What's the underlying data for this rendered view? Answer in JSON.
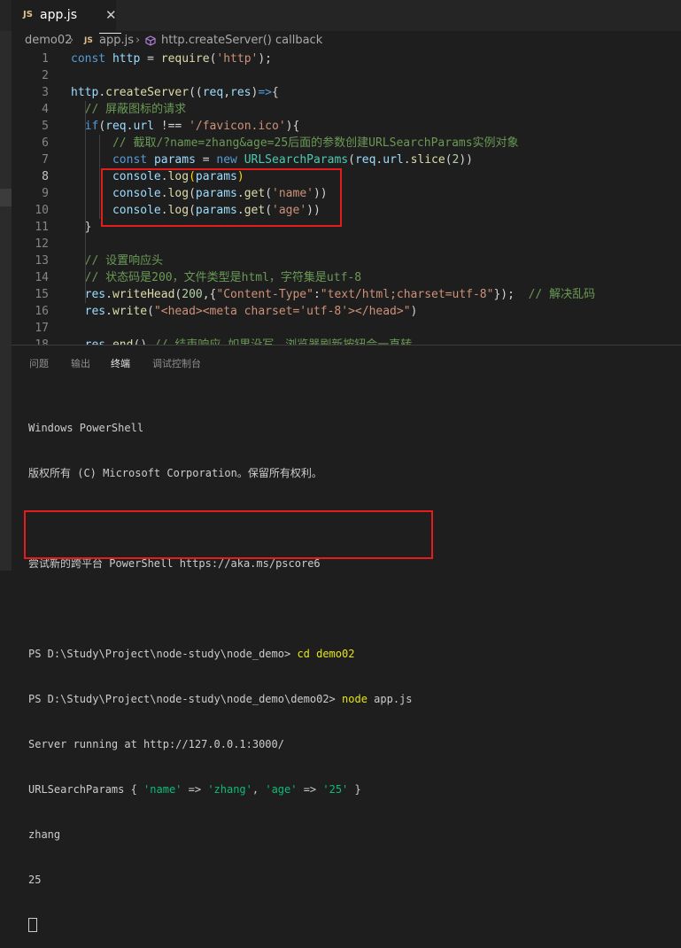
{
  "tab": {
    "icon": "JS",
    "title": "app.js",
    "close": "✕"
  },
  "breadcrumb": {
    "folder": "demo02",
    "file_icon": "JS",
    "file": "app.js",
    "symbol": "http.createServer() callback"
  },
  "editor": {
    "lines": [
      {
        "n": "1",
        "tokens": [
          {
            "t": "const ",
            "c": "k"
          },
          {
            "t": "http",
            "c": "v"
          },
          {
            "t": " = ",
            "c": "p"
          },
          {
            "t": "require",
            "c": "f"
          },
          {
            "t": "(",
            "c": "p"
          },
          {
            "t": "'http'",
            "c": "s"
          },
          {
            "t": ");",
            "c": "p"
          }
        ]
      },
      {
        "n": "2",
        "tokens": []
      },
      {
        "n": "3",
        "tokens": [
          {
            "t": "http",
            "c": "v"
          },
          {
            "t": ".",
            "c": "p"
          },
          {
            "t": "createServer",
            "c": "f"
          },
          {
            "t": "((",
            "c": "p"
          },
          {
            "t": "req",
            "c": "v"
          },
          {
            "t": ",",
            "c": "p"
          },
          {
            "t": "res",
            "c": "v"
          },
          {
            "t": ")",
            "c": "p"
          },
          {
            "t": "=>",
            "c": "k"
          },
          {
            "t": "{",
            "c": "p"
          }
        ]
      },
      {
        "n": "4",
        "tokens": [
          {
            "t": "  // 屏蔽图标的请求",
            "c": "c"
          }
        ]
      },
      {
        "n": "5",
        "tokens": [
          {
            "t": "  ",
            "c": "p"
          },
          {
            "t": "if",
            "c": "k"
          },
          {
            "t": "(",
            "c": "p"
          },
          {
            "t": "req",
            "c": "v"
          },
          {
            "t": ".",
            "c": "p"
          },
          {
            "t": "url",
            "c": "v"
          },
          {
            "t": " !== ",
            "c": "p"
          },
          {
            "t": "'/favicon.ico'",
            "c": "s"
          },
          {
            "t": "){",
            "c": "p"
          }
        ]
      },
      {
        "n": "6",
        "tokens": [
          {
            "t": "      // 截取/?name=zhang&age=25后面的参数创建URLSearchParams实例对象",
            "c": "c"
          }
        ]
      },
      {
        "n": "7",
        "tokens": [
          {
            "t": "      ",
            "c": "p"
          },
          {
            "t": "const ",
            "c": "k"
          },
          {
            "t": "params",
            "c": "v"
          },
          {
            "t": " = ",
            "c": "p"
          },
          {
            "t": "new ",
            "c": "k"
          },
          {
            "t": "URLSearchParams",
            "c": "t"
          },
          {
            "t": "(",
            "c": "p"
          },
          {
            "t": "req",
            "c": "v"
          },
          {
            "t": ".",
            "c": "p"
          },
          {
            "t": "url",
            "c": "v"
          },
          {
            "t": ".",
            "c": "p"
          },
          {
            "t": "slice",
            "c": "f"
          },
          {
            "t": "(",
            "c": "p"
          },
          {
            "t": "2",
            "c": "n"
          },
          {
            "t": "))",
            "c": "p"
          }
        ]
      },
      {
        "n": "8",
        "active": true,
        "tokens": [
          {
            "t": "      ",
            "c": "p"
          },
          {
            "t": "console",
            "c": "v"
          },
          {
            "t": ".",
            "c": "p"
          },
          {
            "t": "log",
            "c": "f"
          },
          {
            "t": "(",
            "c": "y"
          },
          {
            "t": "params",
            "c": "v"
          },
          {
            "t": ")",
            "c": "y"
          }
        ]
      },
      {
        "n": "9",
        "tokens": [
          {
            "t": "      ",
            "c": "p"
          },
          {
            "t": "console",
            "c": "v"
          },
          {
            "t": ".",
            "c": "p"
          },
          {
            "t": "log",
            "c": "f"
          },
          {
            "t": "(",
            "c": "p"
          },
          {
            "t": "params",
            "c": "v"
          },
          {
            "t": ".",
            "c": "p"
          },
          {
            "t": "get",
            "c": "f"
          },
          {
            "t": "(",
            "c": "p"
          },
          {
            "t": "'name'",
            "c": "s"
          },
          {
            "t": "))",
            "c": "p"
          }
        ]
      },
      {
        "n": "10",
        "tokens": [
          {
            "t": "      ",
            "c": "p"
          },
          {
            "t": "console",
            "c": "v"
          },
          {
            "t": ".",
            "c": "p"
          },
          {
            "t": "log",
            "c": "f"
          },
          {
            "t": "(",
            "c": "p"
          },
          {
            "t": "params",
            "c": "v"
          },
          {
            "t": ".",
            "c": "p"
          },
          {
            "t": "get",
            "c": "f"
          },
          {
            "t": "(",
            "c": "p"
          },
          {
            "t": "'age'",
            "c": "s"
          },
          {
            "t": "))",
            "c": "p"
          }
        ]
      },
      {
        "n": "11",
        "tokens": [
          {
            "t": "  }",
            "c": "p"
          }
        ]
      },
      {
        "n": "12",
        "tokens": []
      },
      {
        "n": "13",
        "tokens": [
          {
            "t": "  // 设置响应头",
            "c": "c"
          }
        ]
      },
      {
        "n": "14",
        "tokens": [
          {
            "t": "  // 状态码是200，文件类型是html，字符集是utf-8",
            "c": "c"
          }
        ]
      },
      {
        "n": "15",
        "tokens": [
          {
            "t": "  ",
            "c": "p"
          },
          {
            "t": "res",
            "c": "v"
          },
          {
            "t": ".",
            "c": "p"
          },
          {
            "t": "writeHead",
            "c": "f"
          },
          {
            "t": "(",
            "c": "p"
          },
          {
            "t": "200",
            "c": "n"
          },
          {
            "t": ",{",
            "c": "p"
          },
          {
            "t": "\"Content-Type\"",
            "c": "s"
          },
          {
            "t": ":",
            "c": "p"
          },
          {
            "t": "\"text/html;charset=utf-8\"",
            "c": "s"
          },
          {
            "t": "});  ",
            "c": "p"
          },
          {
            "t": "// 解决乱码",
            "c": "c"
          }
        ]
      },
      {
        "n": "16",
        "tokens": [
          {
            "t": "  ",
            "c": "p"
          },
          {
            "t": "res",
            "c": "v"
          },
          {
            "t": ".",
            "c": "p"
          },
          {
            "t": "write",
            "c": "f"
          },
          {
            "t": "(",
            "c": "p"
          },
          {
            "t": "\"<head><meta charset='utf-8'></head>\"",
            "c": "s"
          },
          {
            "t": ")",
            "c": "p"
          }
        ]
      },
      {
        "n": "17",
        "tokens": []
      },
      {
        "n": "18",
        "tokens": [
          {
            "t": "  ",
            "c": "p"
          },
          {
            "t": "res",
            "c": "v"
          },
          {
            "t": ".",
            "c": "p"
          },
          {
            "t": "end",
            "c": "f"
          },
          {
            "t": "() ",
            "c": "p"
          },
          {
            "t": "// 结束响应,如果没写，浏览器刷新按钮会一直转",
            "c": "c"
          }
        ]
      }
    ]
  },
  "panel": {
    "tabs": [
      "问题",
      "输出",
      "终端",
      "调试控制台"
    ],
    "active_tab": "终端"
  },
  "terminal": {
    "l1": "Windows PowerShell",
    "l2": "版权所有 (C) Microsoft Corporation。保留所有权利。",
    "l3": "尝试新的跨平台 PowerShell https://aka.ms/pscore6",
    "prompt1": "PS D:\\Study\\Project\\node-study\\node_demo> ",
    "cmd1": "cd demo02",
    "prompt2": "PS D:\\Study\\Project\\node-study\\node_demo\\demo02> ",
    "cmd2_a": "node",
    "cmd2_b": " app.js",
    "server": "Server running at http://127.0.0.1:3000/",
    "usp_a": "URLSearchParams { ",
    "usp_k1": "'name'",
    "usp_arrow1": " => ",
    "usp_v1": "'zhang'",
    "usp_sep": ", ",
    "usp_k2": "'age'",
    "usp_arrow2": " => ",
    "usp_v2": "'25'",
    "usp_end": " }",
    "out1": "zhang",
    "out2": "25"
  }
}
